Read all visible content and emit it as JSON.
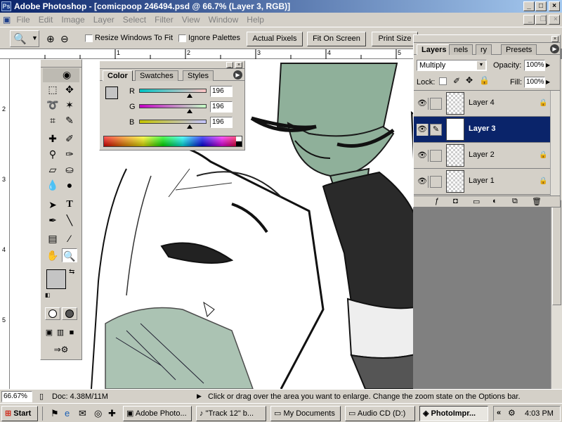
{
  "window": {
    "title": "Adobe Photoshop - [comicpoop 246494.psd @ 66.7% (Layer 3, RGB)]",
    "app_icon": "photoshop-icon"
  },
  "menu": [
    "File",
    "Edit",
    "Image",
    "Layer",
    "Select",
    "Filter",
    "View",
    "Window",
    "Help"
  ],
  "options_bar": {
    "tool_icon": "zoom-tool-icon",
    "resize_windows_label": "Resize Windows To Fit",
    "ignore_palettes_label": "Ignore Palettes",
    "actual_pixels_label": "Actual Pixels",
    "fit_on_screen_label": "Fit On Screen",
    "print_size_label": "Print Size"
  },
  "rulers": {
    "top": [
      "1",
      "2",
      "3",
      "4",
      "5"
    ],
    "left": [
      "2",
      "3",
      "4",
      "5"
    ]
  },
  "color_palette": {
    "tabs": [
      "Color",
      "Swatches",
      "Styles"
    ],
    "active_tab": "Color",
    "channels": [
      {
        "label": "R",
        "value": "196"
      },
      {
        "label": "G",
        "value": "196"
      },
      {
        "label": "B",
        "value": "196"
      }
    ]
  },
  "layers_palette": {
    "tabs": [
      "Layers",
      "nels",
      "ry",
      "Presets"
    ],
    "active_tab": "Layers",
    "blend_mode": "Multiply",
    "opacity_label": "Opacity:",
    "opacity_value": "100%",
    "lock_label": "Lock:",
    "fill_label": "Fill:",
    "fill_value": "100%",
    "layers": [
      {
        "name": "Layer 4",
        "selected": false,
        "locked": true
      },
      {
        "name": "Layer 3",
        "selected": true,
        "locked": false
      },
      {
        "name": "Layer 2",
        "selected": false,
        "locked": true
      },
      {
        "name": "Layer 1",
        "selected": false,
        "locked": true
      }
    ]
  },
  "status_bar": {
    "zoom": "66.67%",
    "doc": "Doc: 4.38M/11M",
    "hint": "Click or drag over the area you want to enlarge. Change the zoom state on the Options bar."
  },
  "taskbar": {
    "start_label": "Start",
    "items": [
      "Adobe Photo...",
      "\"Track 12\" b...",
      "My Documents",
      "Audio CD (D:)",
      "PhotoImpr..."
    ],
    "active_item": "PhotoImpr...",
    "clock": "4:03 PM",
    "chevron": "«"
  },
  "colors": {
    "title_blue": "#0a246a",
    "chrome": "#d4d0c8",
    "sketch_green": "#8fb09a"
  }
}
